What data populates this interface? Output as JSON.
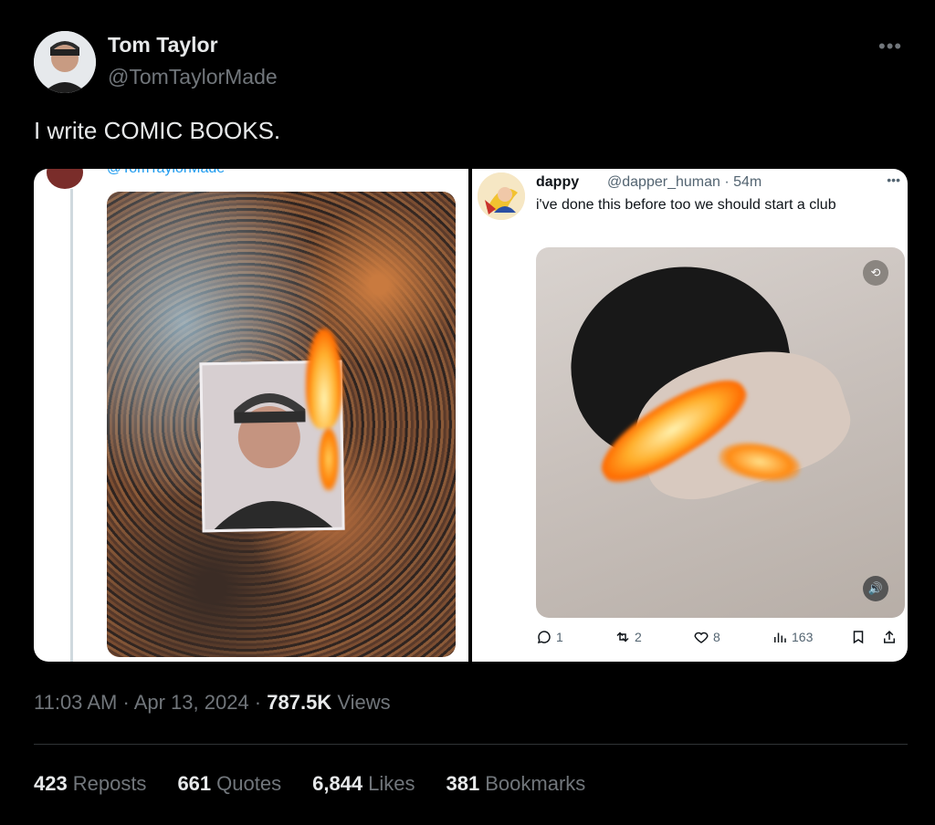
{
  "author": {
    "name": "Tom Taylor",
    "handle": "@TomTaylorMade"
  },
  "tweet_text": "I write COMIC BOOKS.",
  "media": {
    "left": {
      "cropped_handle": "@TomTaylorMade"
    },
    "right": {
      "name": "dappy",
      "handle": "@dapper_human · 54m",
      "text": "i've done this before too we should start a club",
      "counts": {
        "replies": "1",
        "reposts": "2",
        "likes": "8",
        "views": "163"
      }
    }
  },
  "meta": {
    "time": "11:03 AM",
    "date": "Apr 13, 2024",
    "views_value": "787.5K",
    "views_label": "Views"
  },
  "stats": {
    "reposts": {
      "value": "423",
      "label": "Reposts"
    },
    "quotes": {
      "value": "661",
      "label": "Quotes"
    },
    "likes": {
      "value": "6,844",
      "label": "Likes"
    },
    "bookmarks": {
      "value": "381",
      "label": "Bookmarks"
    }
  },
  "icons": [
    "more-horizontal-icon",
    "reply-icon",
    "repost-icon",
    "like-icon",
    "views-icon",
    "bookmark-icon",
    "share-icon"
  ]
}
